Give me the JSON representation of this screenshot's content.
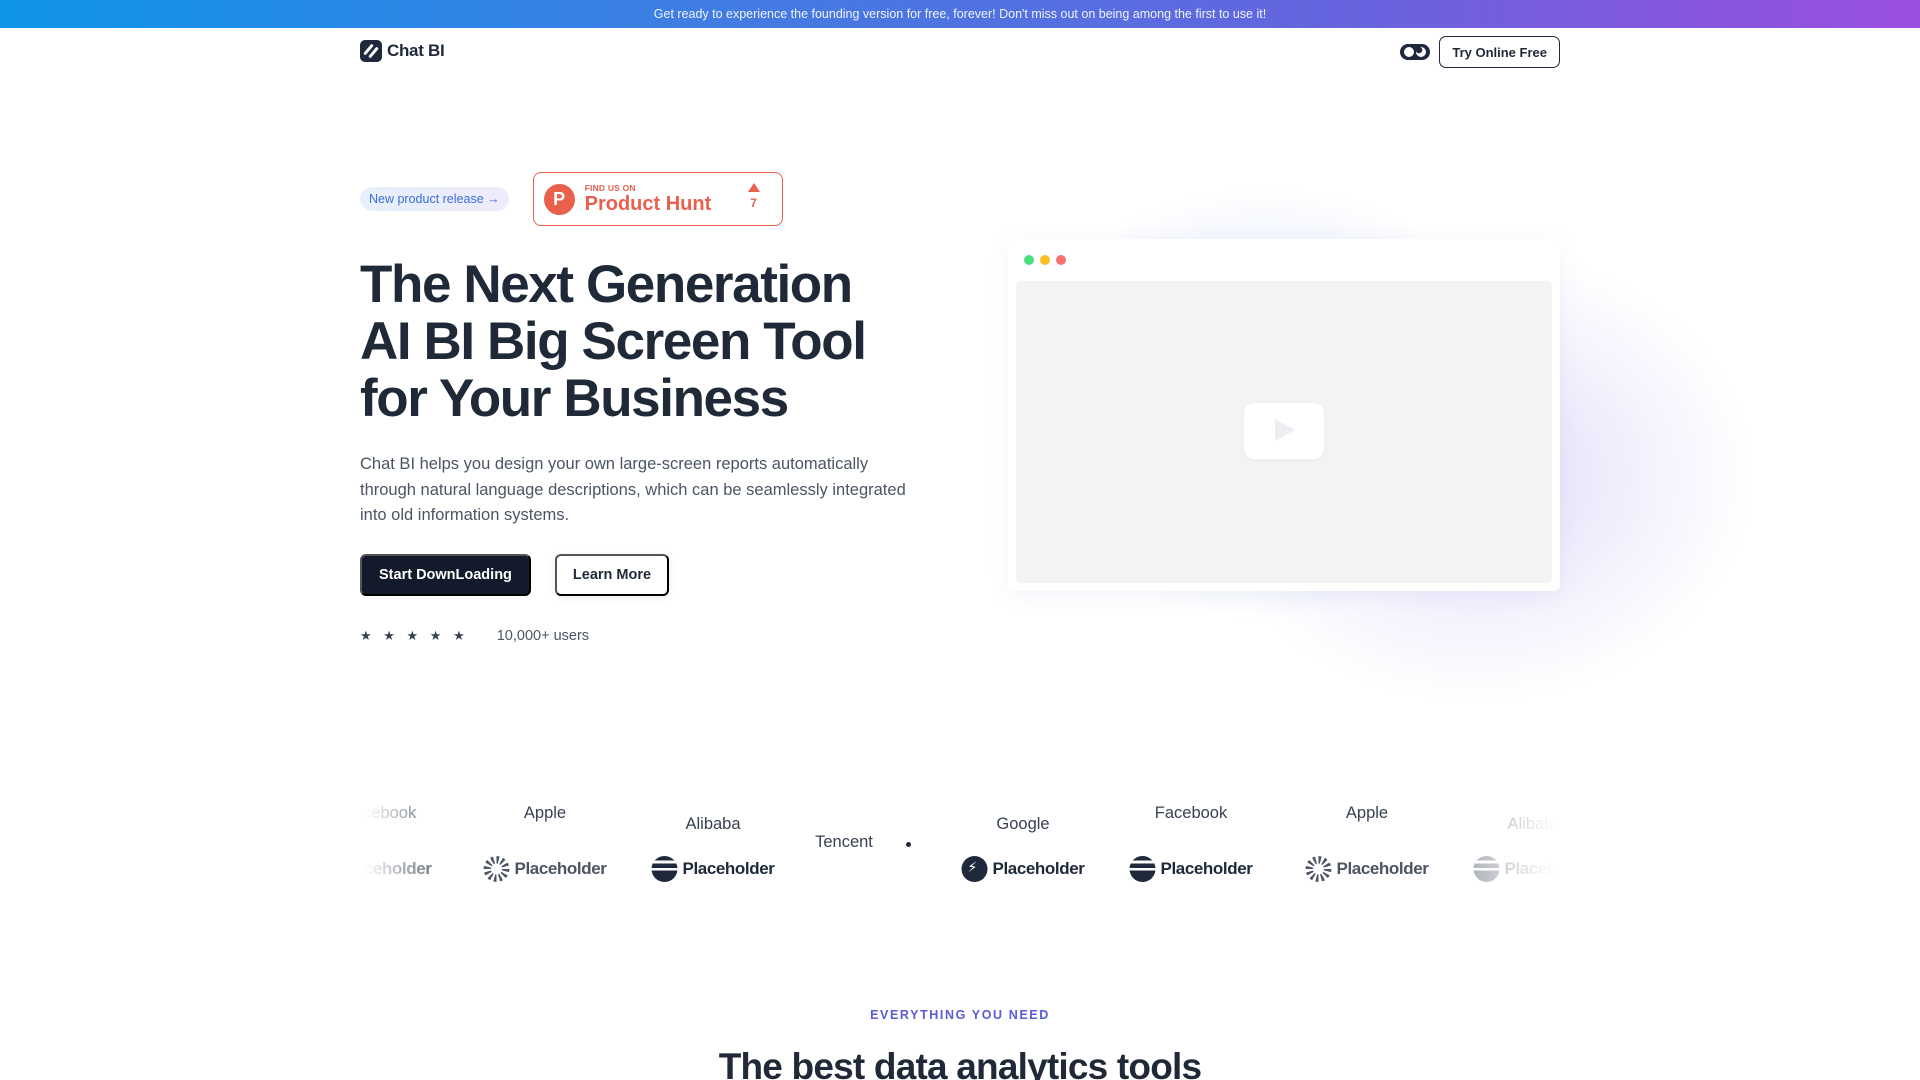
{
  "banner": {
    "text": "Get ready to experience the founding version for free, forever! Don't miss out on being among the first to use it!"
  },
  "nav": {
    "logo_text": "Chat BI",
    "logo_icon": "slash-logo-icon",
    "theme_toggle_icon": "theme-toggle-icon",
    "try_button": "Try Online Free"
  },
  "hero": {
    "release_pill": "New product release →",
    "product_hunt": {
      "small": "FIND US ON",
      "big": "Product Hunt",
      "logo_letter": "P",
      "votes": "7",
      "accent": "#e9604d"
    },
    "headline_lines": [
      "The Next Generation",
      "AI BI Big Screen Tool",
      "for Your Business"
    ],
    "description": "Chat BI helps you design your own large-screen reports automatically through natural language descriptions, which can be seamlessly integrated into old information systems.",
    "primary_button": "Start DownLoading",
    "secondary_button": "Learn More",
    "stars": "★ ★ ★ ★ ★",
    "rating_stars": 5,
    "users": "10,000+ users"
  },
  "video": {
    "window_dots": [
      "#4ade80",
      "#fbbf24",
      "#f87171"
    ],
    "play_icon": "play-icon"
  },
  "brands": {
    "names": [
      "Facebook",
      "Apple",
      "Alibaba",
      "Tencent",
      "Google",
      "Facebook",
      "Apple",
      "Alibaba"
    ],
    "logos": [
      {
        "label": "Placeholder",
        "icon": "sun-icon"
      },
      {
        "label": "Placeholder",
        "icon": "sun-icon"
      },
      {
        "label": "Placeholder",
        "icon": "wave-icon"
      },
      {
        "label": "Placeholder",
        "icon": "bolt-icon"
      },
      {
        "label": "Placeholder",
        "icon": "wave-icon"
      },
      {
        "label": "Placeholder",
        "icon": "sun-icon"
      },
      {
        "label": "Placeholder",
        "icon": "wave-icon"
      }
    ]
  },
  "features": {
    "eyebrow": "EVERYTHING YOU NEED",
    "title": "The best data analytics tools"
  },
  "colors": {
    "primary_dark": "#121a2b",
    "text": "#1f2937",
    "accent_indigo": "#5b5bd6"
  }
}
